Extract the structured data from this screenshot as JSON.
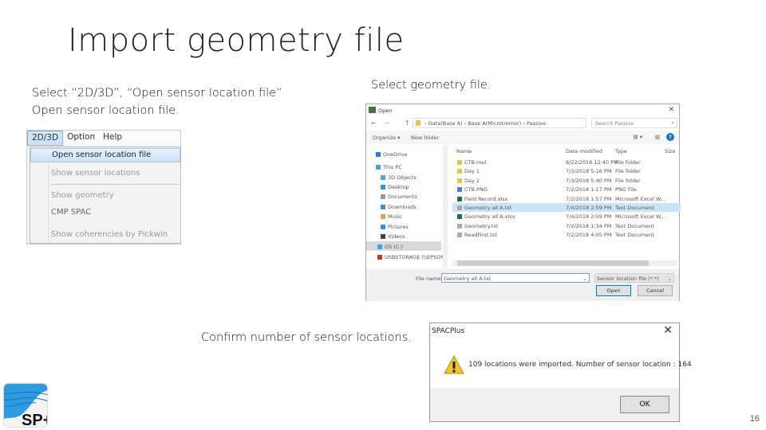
{
  "title": "Import geometry file",
  "step1": {
    "line1": "Select “2D/3D”, “Open sensor location file”",
    "line2": "Open sensor location file."
  },
  "step2": "Select geometry file.",
  "step3": "Confirm number of sensor locations.",
  "menu": {
    "bar": [
      "2D/3D",
      "Option",
      "Help"
    ],
    "items": [
      "Open sensor location file",
      "Show sensor locations",
      "Show geometry",
      "CMP SPAC",
      "Show coherencies by Pickwin"
    ]
  },
  "dialog": {
    "title": "Open",
    "path": [
      "Data(Base A)",
      "Base A(Microtremor)",
      "Passive"
    ],
    "search_placeholder": "Search Passive",
    "organize": "Organize ▾",
    "new_folder": "New folder",
    "columns": [
      "Name",
      "Date modified",
      "Type",
      "Size"
    ],
    "files": [
      {
        "name": "CTB.mul",
        "date": "8/22/2018 12:40 PM",
        "type": "File folder",
        "icon": "folder"
      },
      {
        "name": "Day 1",
        "date": "7/3/2018 5:16 PM",
        "type": "File folder",
        "icon": "folder"
      },
      {
        "name": "Day 2",
        "date": "7/3/2018 5:40 PM",
        "type": "File folder",
        "icon": "folder"
      },
      {
        "name": "CTB.PNG",
        "date": "7/2/2018 1:17 PM",
        "type": "PNG File",
        "icon": "image"
      },
      {
        "name": "Field Record.xlsx",
        "date": "7/2/2018 1:57 PM",
        "type": "Microsoft Excel W...",
        "icon": "excel"
      },
      {
        "name": "Geometry all A.txt",
        "date": "7/4/2018 2:59 PM",
        "type": "Text Document",
        "icon": "text"
      },
      {
        "name": "Geometry all A.xlsx",
        "date": "7/4/2018 2:59 PM",
        "type": "Microsoft Excel W...",
        "icon": "excel"
      },
      {
        "name": "Geometry.txt",
        "date": "7/2/2018 1:34 PM",
        "type": "Text Document",
        "icon": "text"
      },
      {
        "name": "ReadFirst.txt",
        "date": "7/2/2018 4:05 PM",
        "type": "Text Document",
        "icon": "text"
      }
    ],
    "nav": [
      "OneDrive",
      "This PC",
      "3D Objects",
      "Desktop",
      "Documents",
      "Downloads",
      "Music",
      "Pictures",
      "Videos",
      "OS (C:)",
      "USBSTORAGE (\\\\EPSON"
    ],
    "file_name_label": "File name:",
    "file_name": "Geometry all A.txt",
    "filter": "Sensor location file (*.*)",
    "open": "Open",
    "cancel": "Cancel"
  },
  "msgbox": {
    "title": "SPACPlus",
    "message": "109 locations were imported. Number of sensor location : 164",
    "ok": "OK"
  },
  "logo_text": "SP+",
  "page_number": "16"
}
